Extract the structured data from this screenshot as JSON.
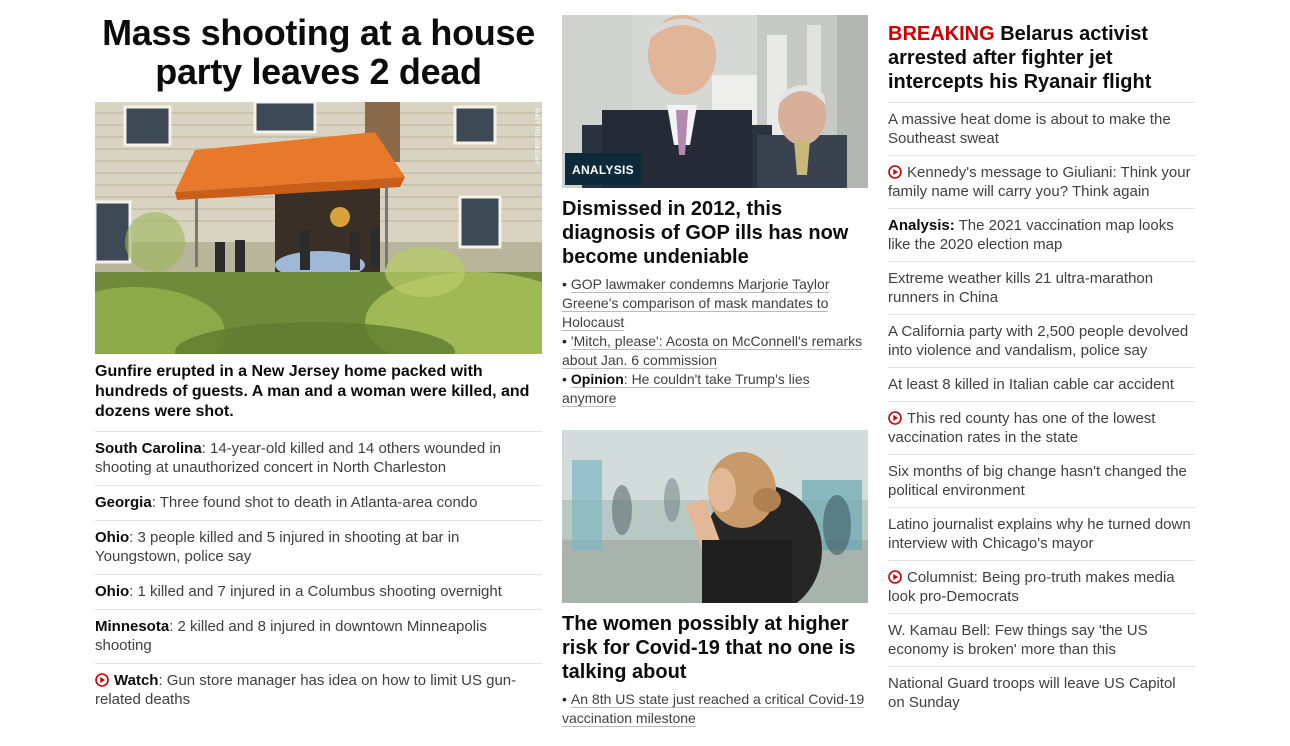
{
  "left": {
    "headline": "Mass shooting at a house party leaves 2 dead",
    "photo_credit": "MATT ROURKE/AP",
    "summary": "Gunfire erupted in a New Jersey home packed with hundreds of guests. A man and a woman were killed, and dozens were shot.",
    "stories": [
      {
        "lead": "South Carolina",
        "text": ": 14-year-old killed and 14 others wounded in shooting at unauthorized concert in North Charleston",
        "video": false
      },
      {
        "lead": "Georgia",
        "text": ": Three found shot to death in Atlanta-area condo",
        "video": false
      },
      {
        "lead": "Ohio",
        "text": ": 3 people killed and 5 injured in shooting at bar in Youngstown, police say",
        "video": false
      },
      {
        "lead": "Ohio",
        "text": ": 1 killed and 7 injured in a Columbus shooting overnight",
        "video": false
      },
      {
        "lead": "Minnesota",
        "text": ": 2 killed and 8 injured in downtown Minneapolis shooting",
        "video": false
      },
      {
        "lead": "Watch",
        "text": ": Gun store manager has idea on how to limit US gun-related deaths",
        "video": true
      }
    ]
  },
  "middle": {
    "story1": {
      "badge": "ANALYSIS",
      "headline": "Dismissed in 2012, this diagnosis of GOP ills has now become undeniable",
      "bullets": [
        {
          "lead": "",
          "text": "GOP lawmaker condemns Marjorie Taylor Greene's comparison of mask mandates to Holocaust"
        },
        {
          "lead": "",
          "text": "'Mitch, please': Acosta on McConnell's remarks about Jan. 6 commission"
        },
        {
          "lead": "Opinion",
          "text": ": He couldn't take Trump's lies anymore"
        }
      ]
    },
    "story2": {
      "headline": "The women possibly at higher risk for Covid-19 that no one is talking about",
      "bullets": [
        {
          "lead": "",
          "text": "An 8th US state just reached a critical Covid-19 vaccination milestone"
        }
      ]
    },
    "bullet_char": "•"
  },
  "right": {
    "breaking_label": "BREAKING",
    "breaking_headline": "Belarus activist arrested after fighter jet intercepts his Ryanair flight",
    "stories": [
      {
        "lead": "",
        "text": "A massive heat dome is about to make the Southeast sweat",
        "video": false
      },
      {
        "lead": "",
        "text": "Kennedy's message to Giuliani: Think your family name will carry you? Think again",
        "video": true
      },
      {
        "lead": "Analysis:",
        "text": " The 2021 vaccination map looks like the 2020 election map",
        "video": false
      },
      {
        "lead": "",
        "text": "Extreme weather kills 21 ultra-marathon runners in China",
        "video": false
      },
      {
        "lead": "",
        "text": "A California party with 2,500 people devolved into violence and vandalism, police say",
        "video": false
      },
      {
        "lead": "",
        "text": "At least 8 killed in Italian cable car accident",
        "video": false
      },
      {
        "lead": "",
        "text": "This red county has one of the lowest vaccination rates in the state",
        "video": true
      },
      {
        "lead": "",
        "text": "Six months of big change hasn't changed the political environment",
        "video": false
      },
      {
        "lead": "",
        "text": "Latino journalist explains why he turned down interview with Chicago's mayor",
        "video": false
      },
      {
        "lead": "",
        "text": "Columnist: Being pro-truth makes media look pro-Democrats",
        "video": true
      },
      {
        "lead": "",
        "text": "W. Kamau Bell: Few things say 'the US economy is broken' more than this",
        "video": false
      },
      {
        "lead": "",
        "text": "National Guard troops will leave US Capitol on Sunday",
        "video": false
      }
    ]
  },
  "colors": {
    "breaking_red": "#cc0000",
    "video_icon_red": "#cc0000",
    "badge_bg": "#0c2a3a",
    "headline_text": "#0c0c0c",
    "body_text": "#404040",
    "divider": "#e2e2e2"
  },
  "icons": {
    "video": "play-circle-icon"
  }
}
